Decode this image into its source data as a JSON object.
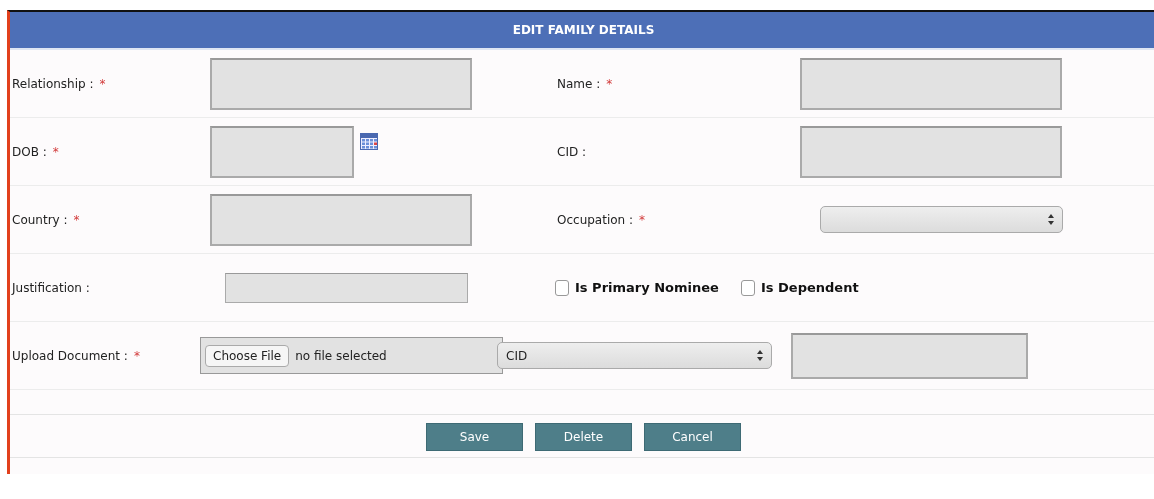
{
  "panel": {
    "title": "EDIT FAMILY DETAILS"
  },
  "rows": [
    {
      "left": {
        "label": "Relationship :",
        "mark": "*",
        "kind": "text"
      },
      "right": {
        "label": "Name :",
        "mark": "*",
        "kind": "text"
      }
    },
    {
      "left": {
        "label": "DOB :",
        "mark": "*",
        "kind": "date"
      },
      "right": {
        "label": "CID :",
        "kind": "text"
      }
    },
    {
      "left": {
        "label": "Country :",
        "mark": "*",
        "kind": "text"
      },
      "right": {
        "label": "Occupation :",
        "mark": "*",
        "kind": "select"
      }
    },
    {
      "left": {
        "label": "Justification :",
        "kind": "short"
      },
      "checkboxes": [
        {
          "label": "Is Primary Nominee",
          "checked": false
        },
        {
          "label": "Is Dependent",
          "checked": false
        }
      ]
    }
  ],
  "upload": {
    "label": "Upload Document :",
    "mark": "*",
    "button": "Choose File",
    "status": "no file selected",
    "doc_type": "CID"
  },
  "buttons": [
    "Save",
    "Delete",
    "Cancel"
  ]
}
